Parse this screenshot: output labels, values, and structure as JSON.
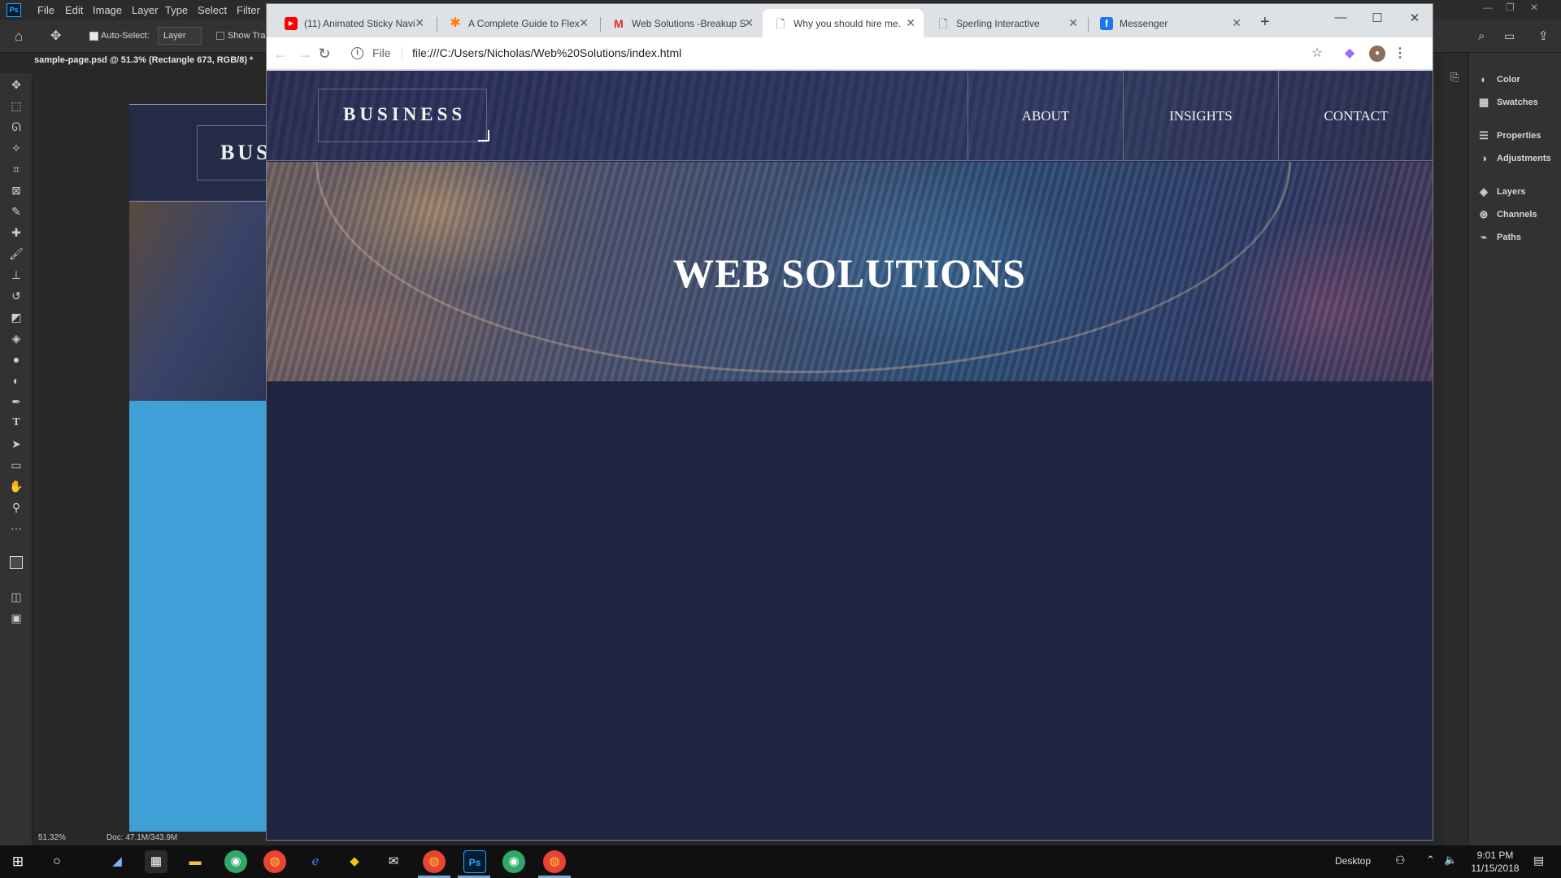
{
  "photoshop": {
    "menu": [
      "File",
      "Edit",
      "Image",
      "Layer",
      "Type",
      "Select",
      "Filter"
    ],
    "options": {
      "auto_select_label": "Auto-Select:",
      "layer_select": "Layer",
      "show_transform_label": "Show Tran"
    },
    "doc_tab": "sample-page.psd @ 51.3% (Rectangle 673, RGB/8) *",
    "doc_logo_text": "BUS",
    "status": {
      "zoom": "51.32%",
      "doc_size": "Doc: 47.1M/343.9M"
    },
    "panels": [
      "Color",
      "Swatches",
      "Properties",
      "Adjustments",
      "Layers",
      "Channels",
      "Paths"
    ]
  },
  "browser": {
    "tabs": [
      {
        "title": "(11) Animated Sticky Navi",
        "icon": "youtube-icon",
        "color": "#ff0000"
      },
      {
        "title": "A Complete Guide to Flex",
        "icon": "css-tricks-icon",
        "color": "#ff7a00"
      },
      {
        "title": "Web Solutions -Breakup S",
        "icon": "gmail-icon",
        "color": "#d93025"
      },
      {
        "title": "Why you should hire me.",
        "icon": "page-icon",
        "active": true
      },
      {
        "title": "Sperling Interactive",
        "icon": "page-icon"
      },
      {
        "title": "Messenger",
        "icon": "facebook-icon",
        "color": "#1877f2"
      }
    ],
    "scheme_label": "File",
    "url": "file:///C:/Users/Nicholas/Web%20Solutions/index.html"
  },
  "site": {
    "brand": "BUSINESS",
    "nav": [
      "ABOUT",
      "INSIGHTS",
      "CONTACT"
    ],
    "hero_title": "WEB SOLUTIONS",
    "background_color": "#202642"
  },
  "taskbar": {
    "desktop_label": "Desktop",
    "time": "9:01 PM",
    "date": "11/15/2018"
  }
}
